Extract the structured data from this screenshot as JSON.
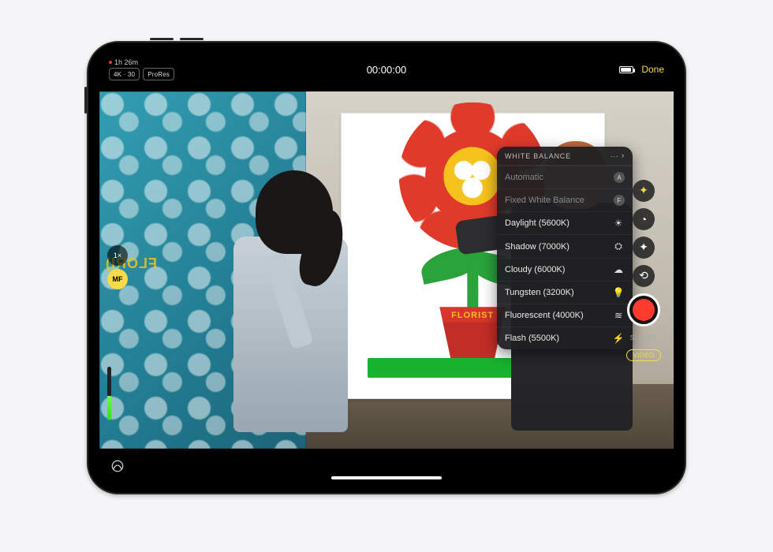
{
  "status": {
    "remaining": "1h 26m"
  },
  "chips": {
    "resolution": "4K · 30",
    "codec": "ProRes"
  },
  "timer": "00:00:00",
  "done_label": "Done",
  "poster_word": "FLORIST",
  "mirror_word": "FLORI)",
  "zoom_label": "1×",
  "mf_label": "MF",
  "modes": {
    "slo": "SLO-MO",
    "video": "VIDEO"
  },
  "wb": {
    "title": "WHITE BALANCE",
    "items": [
      {
        "label": "Automatic",
        "badge": "A",
        "icon": "",
        "dim": true
      },
      {
        "label": "Fixed White Balance",
        "badge": "F",
        "icon": "",
        "dim": true
      },
      {
        "label": "Daylight (5600K)",
        "badge": "",
        "icon": "☀",
        "dim": false
      },
      {
        "label": "Shadow (7000K)",
        "badge": "",
        "icon": "⛭",
        "dim": false
      },
      {
        "label": "Cloudy (6000K)",
        "badge": "",
        "icon": "☁",
        "dim": false
      },
      {
        "label": "Tungsten (3200K)",
        "badge": "",
        "icon": "406",
        "icon_raw": "◐",
        "dim": false
      },
      {
        "label": "Fluorescent (4000K)",
        "badge": "",
        "icon": "≋",
        "dim": false
      },
      {
        "label": "Flash (5500K)",
        "badge": "",
        "icon": "⚡",
        "dim": false
      }
    ]
  }
}
